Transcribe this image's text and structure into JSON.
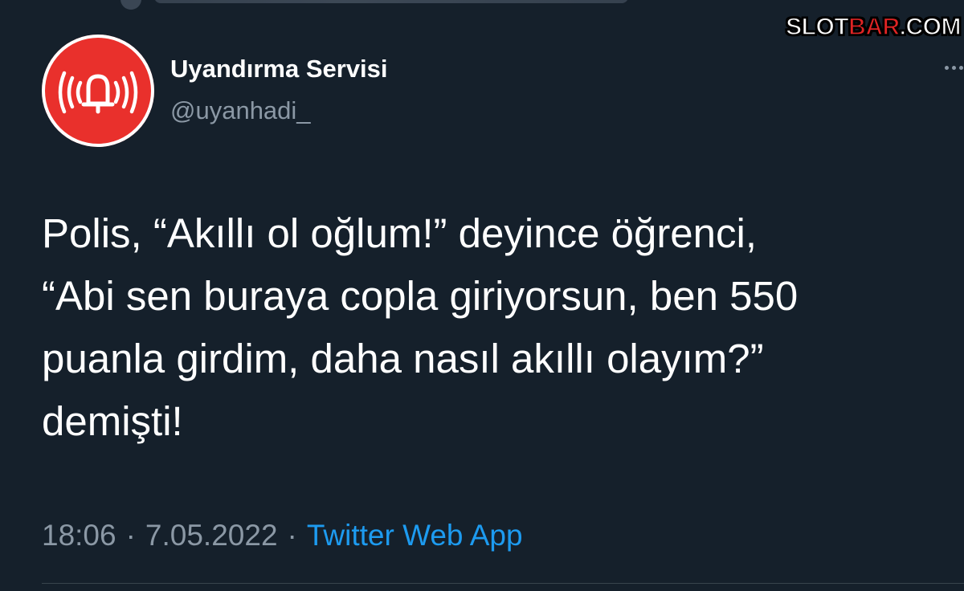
{
  "watermark": {
    "prefix": "SLOT",
    "accent": "BAR",
    "suffix": ".COM",
    "accent_color": "#e02424"
  },
  "profile": {
    "name": "Uyandırma Servisi",
    "handle": "@uyanhadi_",
    "avatar_icon": "ringing-bell-icon",
    "avatar_color": "#e9302c"
  },
  "tweet": {
    "text": "Polis, “Akıllı ol oğlum!” deyince öğrenci,\n“Abi sen buraya copla giriyorsun, ben 550\npuanla girdim, daha nasıl akıllı olayım?”\ndemişti!"
  },
  "meta": {
    "time": "18:06",
    "separator": "·",
    "date": "7.05.2022",
    "source": "Twitter Web App",
    "source_color": "#1d9bf0"
  },
  "colors": {
    "background": "#15202b",
    "text": "#ffffff",
    "muted": "#8b98a5"
  }
}
